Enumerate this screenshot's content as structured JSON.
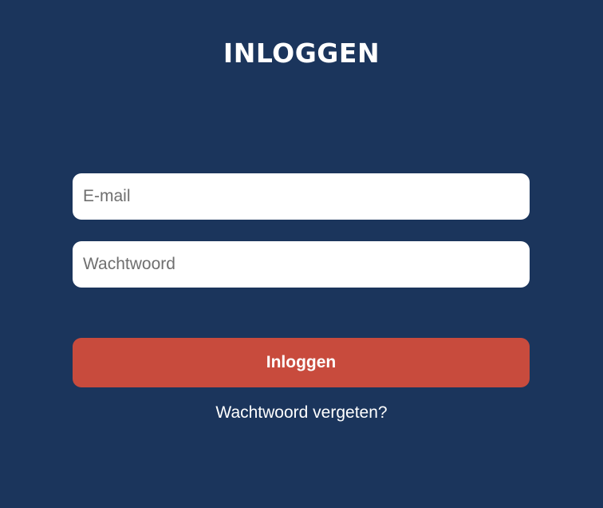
{
  "form": {
    "title": "INLOGGEN",
    "email": {
      "value": "",
      "placeholder": "E-mail"
    },
    "password": {
      "value": "",
      "placeholder": "Wachtwoord"
    },
    "submit_label": "Inloggen",
    "forgot_link": "Wachtwoord vergeten?"
  },
  "colors": {
    "background": "#1b355c",
    "button": "#c84b3d",
    "text": "#ffffff"
  }
}
